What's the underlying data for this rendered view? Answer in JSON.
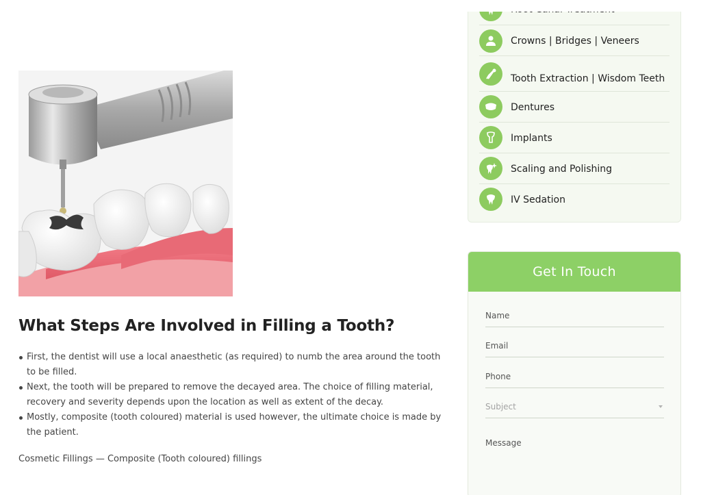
{
  "article": {
    "section_title": "What Steps Are Involved in Filling a Tooth?",
    "steps": [
      "First, the dentist will use a local anaesthetic (as required) to numb the area around the tooth to be filled.",
      "Next, the tooth will be prepared to remove the decayed area. The choice of filling material, recovery and severity depends upon the location as well as extent of the decay.",
      "Mostly, composite (tooth coloured) material is used however, the ultimate choice is made by the patient."
    ],
    "cosmetic_heading": "Cosmetic Fillings — Composite (Tooth coloured) fillings"
  },
  "services": {
    "items": [
      {
        "label": "Root Canal Treatment",
        "icon": "tooth-root-icon"
      },
      {
        "label": "Crowns | Bridges | Veneers",
        "icon": "crown-icon"
      },
      {
        "label": "Tooth Extraction | Wisdom Teeth",
        "icon": "forceps-icon"
      },
      {
        "label": "Dentures",
        "icon": "dentures-icon"
      },
      {
        "label": "Implants",
        "icon": "implant-icon"
      },
      {
        "label": "Scaling and Polishing",
        "icon": "sparkle-tooth-icon"
      },
      {
        "label": "IV Sedation",
        "icon": "tooth-icon"
      }
    ]
  },
  "contact": {
    "title": "Get In Touch",
    "name_placeholder": "Name",
    "email_placeholder": "Email",
    "phone_placeholder": "Phone",
    "subject_placeholder": "Subject",
    "message_placeholder": "Message"
  },
  "colors": {
    "accent_green": "#8dd066",
    "card_bg": "#f5f9f1"
  }
}
